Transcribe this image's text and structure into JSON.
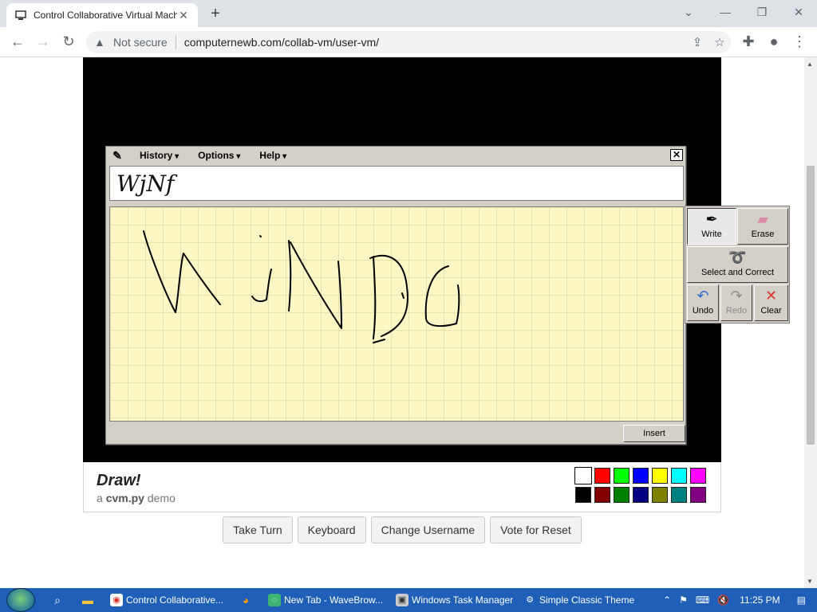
{
  "browser": {
    "tab_title": "Control Collaborative Virtual Machi",
    "tab_close": "✕",
    "new_tab": "+",
    "win_min": "—",
    "win_max": "❐",
    "win_close": "✕",
    "not_secure": "Not secure",
    "url": "computernewb.com/collab-vm/user-vm/"
  },
  "tip": {
    "menu": [
      "History",
      "Options",
      "Help"
    ],
    "close": "✕",
    "recognized": "WjNf",
    "insert": "Insert",
    "tools": {
      "write": "Write",
      "erase": "Erase",
      "select": "Select and Correct",
      "undo": "Undo",
      "redo": "Redo",
      "clear": "Clear"
    }
  },
  "vm_footer": {
    "title": "Draw!",
    "subtitle_prefix": "a",
    "subtitle_brand": "cvm.py",
    "subtitle_suffix": "demo",
    "palette_row1": [
      "#ffffff",
      "#ff0000",
      "#00ff00",
      "#0000ff",
      "#ffff00",
      "#00ffff",
      "#ff00ff"
    ],
    "palette_row2": [
      "#000000",
      "#800000",
      "#008000",
      "#000080",
      "#808000",
      "#008080",
      "#800080"
    ]
  },
  "buttons": [
    "Take Turn",
    "Keyboard",
    "Change Username",
    "Vote for Reset"
  ],
  "taskbar": {
    "items": [
      "Control Collaborative...",
      "New Tab - WaveBrow...",
      "Windows Task Manager",
      "Simple Classic Theme"
    ],
    "time": "11:25 PM"
  }
}
